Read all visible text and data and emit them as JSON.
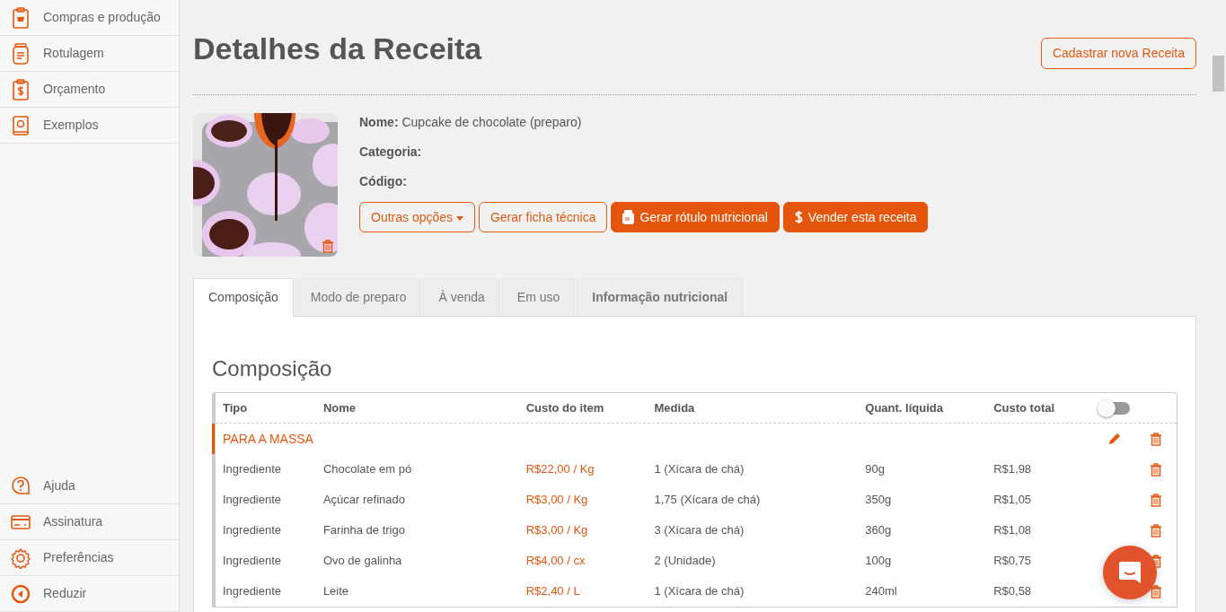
{
  "sidebar": {
    "top_items": [
      {
        "label": "Compras e produção"
      },
      {
        "label": "Rotulagem"
      },
      {
        "label": "Orçamento"
      },
      {
        "label": "Exemplos"
      }
    ],
    "bottom_items": [
      {
        "label": "Ajuda"
      },
      {
        "label": "Assinatura"
      },
      {
        "label": "Preferências"
      },
      {
        "label": "Reduzir"
      }
    ]
  },
  "page_title": "Detalhes da Receita",
  "new_button": "Cadastrar nova Receita",
  "recipe": {
    "fields": [
      {
        "label": "Nome:",
        "value": "Cupcake de chocolate (preparo)"
      },
      {
        "label": "Categoria:"
      },
      {
        "label": "Código:"
      }
    ],
    "buttons": [
      {
        "label": "Outras opções",
        "kind": "dropdown"
      },
      {
        "label": "Gerar ficha técnica",
        "kind": "outline"
      },
      {
        "label": "Gerar rótulo nutricional",
        "kind": "jar"
      },
      {
        "label": "Vender esta receita",
        "kind": "dollar"
      }
    ]
  },
  "tabs": [
    {
      "label": "Composição",
      "selected": true
    },
    {
      "label": "Modo de preparo",
      "selected": false
    },
    {
      "label": "À venda",
      "selected": false
    },
    {
      "label": "Em uso",
      "selected": false
    },
    {
      "label": "Informação nutricional",
      "selected": false,
      "bold": true
    }
  ],
  "section_title": "Composição",
  "table": {
    "columns": [
      "Tipo",
      "Nome",
      "Custo do item",
      "Medida",
      "Quant. líquida",
      "Custo total"
    ],
    "toggle": {
      "on": false
    },
    "rows": [
      {
        "kind": "group",
        "label": "PARA A MASSA"
      },
      {
        "kind": "item",
        "cells": [
          "Ingrediente",
          "Chocolate em pó",
          "R$22,00 / Kg",
          "1 (Xícara de chá)",
          "90g",
          "R$1,98"
        ]
      },
      {
        "kind": "item",
        "cells": [
          "Ingrediente",
          "Açúcar refinado",
          "R$3,00 / Kg",
          "1,75 (Xícara de chá)",
          "350g",
          "R$1,05"
        ]
      },
      {
        "kind": "item",
        "cells": [
          "Ingrediente",
          "Farinha de trigo",
          "R$3,00 / Kg",
          "3 (Xícara de chá)",
          "360g",
          "R$1,08"
        ]
      },
      {
        "kind": "item",
        "cells": [
          "Ingrediente",
          "Ovo de galinha",
          "R$4,00 / cx",
          "2 (Unidade)",
          "100g",
          "R$0,75"
        ]
      },
      {
        "kind": "item",
        "cells": [
          "Ingrediente",
          "Leite",
          "R$2,40 / L",
          "1 (Xícara de chá)",
          "240ml",
          "R$0,58"
        ]
      }
    ]
  }
}
